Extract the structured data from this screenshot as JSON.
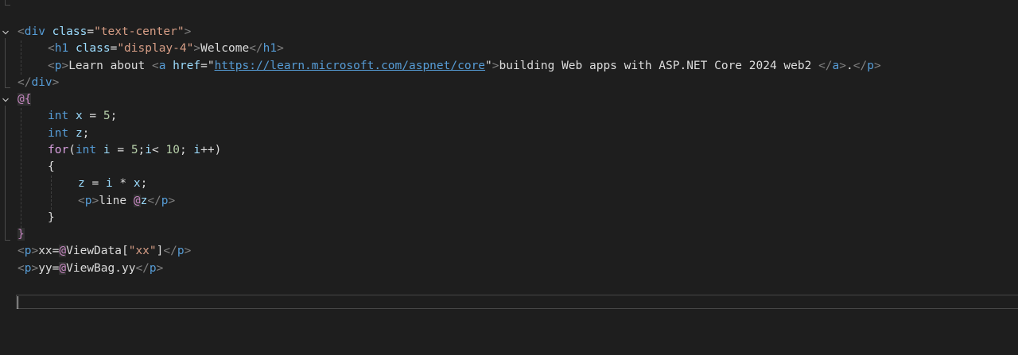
{
  "editor": {
    "lines": [
      {
        "tokens": [
          {
            "c": "bracket",
            "t": "<"
          },
          {
            "c": "tag",
            "t": "div"
          },
          {
            "c": "text",
            "t": " "
          },
          {
            "c": "attr",
            "t": "class"
          },
          {
            "c": "text",
            "t": "="
          },
          {
            "c": "str",
            "t": "\"text-center\""
          },
          {
            "c": "bracket",
            "t": ">"
          }
        ]
      },
      {
        "tokens": [
          {
            "c": "bracket",
            "t": "<"
          },
          {
            "c": "tag",
            "t": "h1"
          },
          {
            "c": "text",
            "t": " "
          },
          {
            "c": "attr",
            "t": "class"
          },
          {
            "c": "text",
            "t": "="
          },
          {
            "c": "str",
            "t": "\"display-4\""
          },
          {
            "c": "bracket",
            "t": ">"
          },
          {
            "c": "text",
            "t": "Welcome"
          },
          {
            "c": "bracket",
            "t": "</"
          },
          {
            "c": "tag",
            "t": "h1"
          },
          {
            "c": "bracket",
            "t": ">"
          }
        ]
      },
      {
        "tokens": [
          {
            "c": "bracket",
            "t": "<"
          },
          {
            "c": "tag",
            "t": "p"
          },
          {
            "c": "bracket",
            "t": ">"
          },
          {
            "c": "text",
            "t": "Learn about "
          },
          {
            "c": "bracket",
            "t": "<"
          },
          {
            "c": "tag",
            "t": "a"
          },
          {
            "c": "text",
            "t": " "
          },
          {
            "c": "attr",
            "t": "href"
          },
          {
            "c": "text",
            "t": "=\""
          },
          {
            "c": "link",
            "t": "https://learn.microsoft.com/aspnet/core"
          },
          {
            "c": "text",
            "t": "\""
          },
          {
            "c": "bracket",
            "t": ">"
          },
          {
            "c": "text",
            "t": "building Web apps with ASP.NET Core 2024 web2 "
          },
          {
            "c": "bracket",
            "t": "</"
          },
          {
            "c": "tag",
            "t": "a"
          },
          {
            "c": "bracket",
            "t": ">"
          },
          {
            "c": "text",
            "t": "."
          },
          {
            "c": "bracket",
            "t": "</"
          },
          {
            "c": "tag",
            "t": "p"
          },
          {
            "c": "bracket",
            "t": ">"
          }
        ]
      },
      {
        "tokens": [
          {
            "c": "bracket",
            "t": "</"
          },
          {
            "c": "tag",
            "t": "div"
          },
          {
            "c": "bracket",
            "t": ">"
          }
        ]
      },
      {
        "tokens": [
          {
            "c": "razor",
            "t": "@{"
          }
        ]
      },
      {
        "tokens": [
          {
            "c": "kw",
            "t": "int"
          },
          {
            "c": "text",
            "t": " "
          },
          {
            "c": "id",
            "t": "x"
          },
          {
            "c": "op",
            "t": " = "
          },
          {
            "c": "num",
            "t": "5"
          },
          {
            "c": "op",
            "t": ";"
          }
        ]
      },
      {
        "tokens": [
          {
            "c": "kw",
            "t": "int"
          },
          {
            "c": "text",
            "t": " "
          },
          {
            "c": "id",
            "t": "z"
          },
          {
            "c": "op",
            "t": ";"
          }
        ]
      },
      {
        "tokens": [
          {
            "c": "ctl",
            "t": "for"
          },
          {
            "c": "op",
            "t": "("
          },
          {
            "c": "kw",
            "t": "int"
          },
          {
            "c": "text",
            "t": " "
          },
          {
            "c": "id",
            "t": "i"
          },
          {
            "c": "op",
            "t": " = "
          },
          {
            "c": "num",
            "t": "5"
          },
          {
            "c": "op",
            "t": ";"
          },
          {
            "c": "id",
            "t": "i"
          },
          {
            "c": "op",
            "t": "< "
          },
          {
            "c": "num",
            "t": "10"
          },
          {
            "c": "op",
            "t": "; "
          },
          {
            "c": "id",
            "t": "i"
          },
          {
            "c": "op",
            "t": "++)"
          }
        ]
      },
      {
        "tokens": [
          {
            "c": "op",
            "t": "{"
          }
        ]
      },
      {
        "tokens": [
          {
            "c": "id",
            "t": "z"
          },
          {
            "c": "op",
            "t": " = "
          },
          {
            "c": "id",
            "t": "i"
          },
          {
            "c": "op",
            "t": " * "
          },
          {
            "c": "id",
            "t": "x"
          },
          {
            "c": "op",
            "t": ";"
          }
        ]
      },
      {
        "tokens": [
          {
            "c": "bracket",
            "t": "<"
          },
          {
            "c": "tag",
            "t": "p"
          },
          {
            "c": "bracket",
            "t": ">"
          },
          {
            "c": "text",
            "t": "line "
          },
          {
            "c": "razor",
            "t": "@"
          },
          {
            "c": "id",
            "t": "z"
          },
          {
            "c": "bracket",
            "t": "</"
          },
          {
            "c": "tag",
            "t": "p"
          },
          {
            "c": "bracket",
            "t": ">"
          }
        ]
      },
      {
        "tokens": [
          {
            "c": "op",
            "t": "}"
          }
        ]
      },
      {
        "tokens": [
          {
            "c": "razor",
            "t": "}"
          }
        ]
      },
      {
        "tokens": [
          {
            "c": "bracket",
            "t": "<"
          },
          {
            "c": "tag",
            "t": "p"
          },
          {
            "c": "bracket",
            "t": ">"
          },
          {
            "c": "text",
            "t": "xx="
          },
          {
            "c": "razor",
            "t": "@"
          },
          {
            "c": "text",
            "t": "ViewData["
          },
          {
            "c": "str",
            "t": "\"xx\""
          },
          {
            "c": "text",
            "t": "]"
          },
          {
            "c": "bracket",
            "t": "</"
          },
          {
            "c": "tag",
            "t": "p"
          },
          {
            "c": "bracket",
            "t": ">"
          }
        ]
      },
      {
        "tokens": [
          {
            "c": "bracket",
            "t": "<"
          },
          {
            "c": "tag",
            "t": "p"
          },
          {
            "c": "bracket",
            "t": ">"
          },
          {
            "c": "text",
            "t": "yy="
          },
          {
            "c": "razor",
            "t": "@"
          },
          {
            "c": "text",
            "t": "ViewBag.yy"
          },
          {
            "c": "bracket",
            "t": "</"
          },
          {
            "c": "tag",
            "t": "p"
          },
          {
            "c": "bracket",
            "t": ">"
          }
        ]
      },
      {
        "tokens": []
      },
      {
        "tokens": []
      }
    ]
  }
}
